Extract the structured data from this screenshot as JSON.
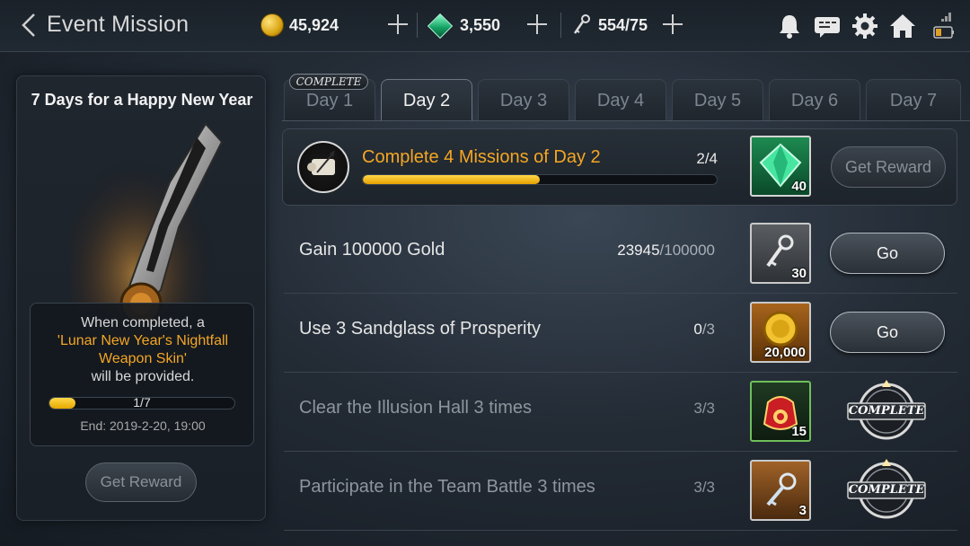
{
  "header": {
    "title": "Event Mission",
    "gold": "45,924",
    "gems": "3,550",
    "stamina": "554/75"
  },
  "event": {
    "title": "7 Days for a Happy New Year",
    "reward_line1": "When completed, a",
    "reward_highlight": "'Lunar New Year's Nightfall Weapon Skin'",
    "reward_line3": "will be provided.",
    "progress_text": "1/7",
    "progress_fraction": 0.14,
    "end_text": "End: 2019-2-20, 19:00",
    "get_reward_label": "Get Reward"
  },
  "tabs": [
    {
      "label": "Day 1",
      "complete_tag": "COMPLETE"
    },
    {
      "label": "Day 2",
      "active": true
    },
    {
      "label": "Day 3"
    },
    {
      "label": "Day 4"
    },
    {
      "label": "Day 5"
    },
    {
      "label": "Day 6"
    },
    {
      "label": "Day 7"
    }
  ],
  "main_mission": {
    "title": "Complete 4 Missions of Day 2",
    "count": "2/4",
    "progress_fraction": 0.5,
    "reward_qty": "40",
    "button_label": "Get Reward"
  },
  "missions": [
    {
      "name": "Gain 100000 Gold",
      "current": "23945",
      "total": "/100000",
      "reward_qty": "30",
      "button_label": "Go"
    },
    {
      "name": "Use 3 Sandglass of Prosperity",
      "current": "0",
      "total": "/3",
      "reward_qty": "20,000",
      "button_label": "Go"
    },
    {
      "name": "Clear the Illusion Hall 3 times",
      "count": "3/3",
      "reward_qty": "15",
      "status": "COMPLETE"
    },
    {
      "name": "Participate in the Team Battle 3 times",
      "count": "3/3",
      "reward_qty": "3",
      "status": "COMPLETE"
    }
  ],
  "colors": {
    "accent": "#f5a623",
    "progress": "#f2c21c",
    "gem": "#17a466"
  }
}
